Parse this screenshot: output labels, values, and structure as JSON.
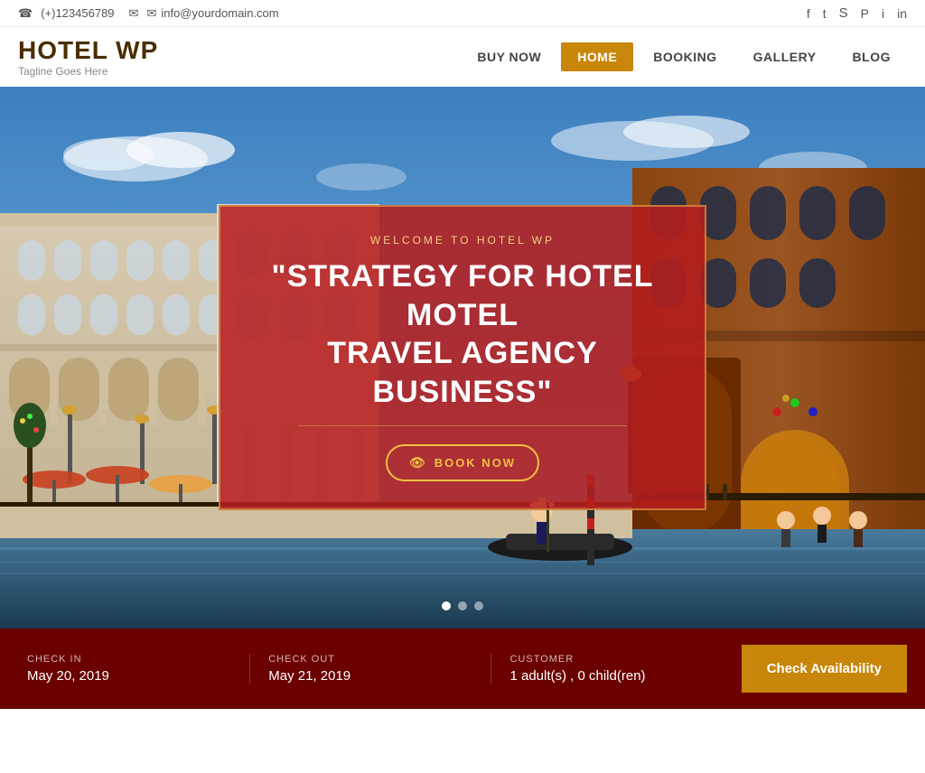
{
  "topbar": {
    "phone": "(+)123456789",
    "email": "info@yourdomain.com",
    "socials": [
      {
        "name": "facebook",
        "icon": "f"
      },
      {
        "name": "twitter",
        "icon": "t"
      },
      {
        "name": "skype",
        "icon": "s"
      },
      {
        "name": "pinterest",
        "icon": "p"
      },
      {
        "name": "instagram",
        "icon": "i"
      },
      {
        "name": "linkedin",
        "icon": "in"
      }
    ]
  },
  "header": {
    "logo_title": "HOTEL WP",
    "logo_tagline": "Tagline Goes Here",
    "nav_items": [
      {
        "label": "BUY NOW",
        "active": false
      },
      {
        "label": "HOME",
        "active": true
      },
      {
        "label": "BOOKING",
        "active": false
      },
      {
        "label": "GALLERY",
        "active": false
      },
      {
        "label": "BLOG",
        "active": false
      }
    ]
  },
  "hero": {
    "welcome_text": "WELCOME TO HOTEL WP",
    "title_line1": "\"STRATEGY FOR HOTEL MOTEL",
    "title_line2": "TRAVEL AGENCY BUSINESS\"",
    "book_button": "BOOK NOW",
    "dots": [
      {
        "active": true
      },
      {
        "active": false
      },
      {
        "active": false
      }
    ]
  },
  "booking": {
    "checkin_label": "CHECK IN",
    "checkin_value": "May 20, 2019",
    "checkout_label": "CHECK OUT",
    "checkout_value": "May 21, 2019",
    "customer_label": "CUSTOMER",
    "customer_value": "1 adult(s) , 0 child(ren)",
    "button_label": "Check Availability"
  }
}
